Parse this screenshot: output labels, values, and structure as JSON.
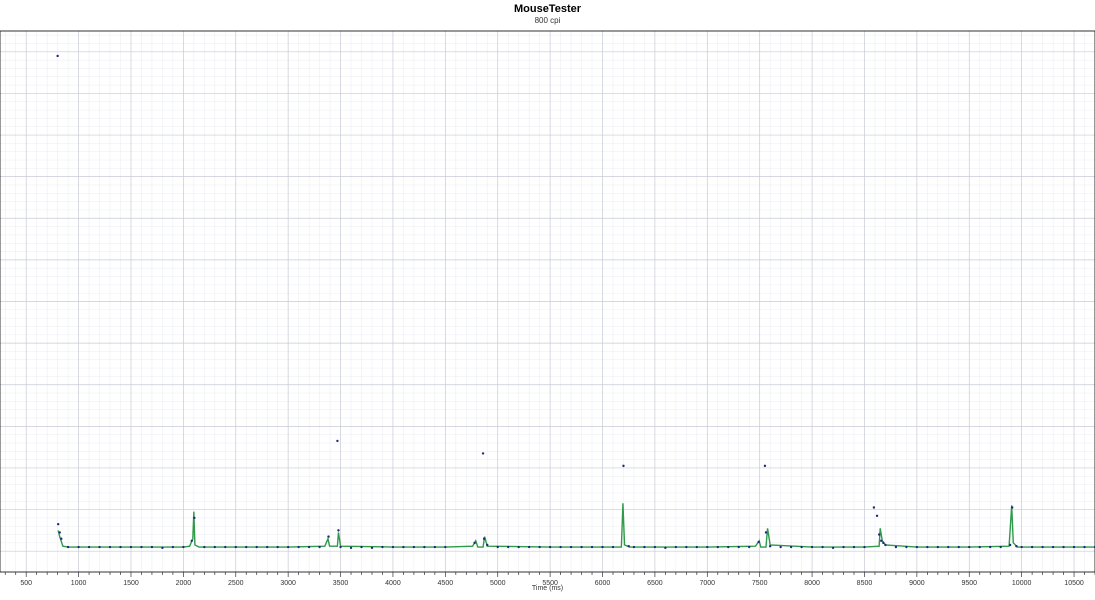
{
  "chart_data": {
    "type": "scatter",
    "title": "MouseTester",
    "subtitle": "800 cpi",
    "xlabel": "Time (ms)",
    "ylabel": "",
    "xlim": [
      250,
      10700
    ],
    "ylim": [
      -0.5,
      12.5
    ],
    "x_major_ticks": [
      500,
      1000,
      1500,
      2000,
      2500,
      3000,
      3500,
      4000,
      4500,
      5000,
      5500,
      6000,
      6500,
      7000,
      7500,
      8000,
      8500,
      9000,
      9500,
      10000,
      10500
    ],
    "x_tick_labels": [
      "500",
      "1000",
      "1500",
      "2000",
      "2500",
      "3000",
      "3500",
      "4000",
      "4500",
      "5000",
      "5500",
      "6000",
      "6500",
      "7000",
      "7500",
      "8000",
      "8500",
      "9000",
      "9500",
      "10000",
      "10500"
    ],
    "grid": true,
    "colors": {
      "points": "#1f2a7a",
      "line": "#2e9a4a",
      "grid_major": "#c8cad6",
      "grid_minor": "#eceef3"
    },
    "series": [
      {
        "kind": "points",
        "points": [
          [
            800,
            11.9
          ],
          [
            805,
            0.65
          ],
          [
            820,
            0.45
          ],
          [
            835,
            0.3
          ],
          [
            900,
            0.1
          ],
          [
            1000,
            0.1
          ],
          [
            1100,
            0.1
          ],
          [
            1200,
            0.1
          ],
          [
            1300,
            0.1
          ],
          [
            1400,
            0.1
          ],
          [
            1500,
            0.1
          ],
          [
            1600,
            0.1
          ],
          [
            1700,
            0.1
          ],
          [
            1800,
            0.08
          ],
          [
            1900,
            0.1
          ],
          [
            2000,
            0.1
          ],
          [
            2080,
            0.25
          ],
          [
            2105,
            0.8
          ],
          [
            2200,
            0.1
          ],
          [
            2300,
            0.1
          ],
          [
            2400,
            0.1
          ],
          [
            2500,
            0.1
          ],
          [
            2600,
            0.1
          ],
          [
            2700,
            0.1
          ],
          [
            2800,
            0.1
          ],
          [
            2900,
            0.1
          ],
          [
            3000,
            0.1
          ],
          [
            3100,
            0.1
          ],
          [
            3200,
            0.1
          ],
          [
            3300,
            0.1
          ],
          [
            3385,
            0.35
          ],
          [
            3470,
            2.65
          ],
          [
            3480,
            0.5
          ],
          [
            3500,
            0.1
          ],
          [
            3600,
            0.08
          ],
          [
            3700,
            0.1
          ],
          [
            3800,
            0.08
          ],
          [
            3900,
            0.1
          ],
          [
            4000,
            0.1
          ],
          [
            4100,
            0.1
          ],
          [
            4200,
            0.1
          ],
          [
            4300,
            0.1
          ],
          [
            4400,
            0.1
          ],
          [
            4500,
            0.1
          ],
          [
            4780,
            0.2
          ],
          [
            4860,
            2.35
          ],
          [
            4870,
            0.3
          ],
          [
            4900,
            0.15
          ],
          [
            5000,
            0.1
          ],
          [
            5100,
            0.1
          ],
          [
            5200,
            0.1
          ],
          [
            5300,
            0.1
          ],
          [
            5400,
            0.1
          ],
          [
            5500,
            0.1
          ],
          [
            5600,
            0.1
          ],
          [
            5700,
            0.1
          ],
          [
            5800,
            0.1
          ],
          [
            5900,
            0.1
          ],
          [
            6000,
            0.1
          ],
          [
            6100,
            0.1
          ],
          [
            6200,
            2.05
          ],
          [
            6250,
            0.12
          ],
          [
            6300,
            0.1
          ],
          [
            6400,
            0.1
          ],
          [
            6500,
            0.1
          ],
          [
            6600,
            0.08
          ],
          [
            6700,
            0.1
          ],
          [
            6800,
            0.1
          ],
          [
            6900,
            0.1
          ],
          [
            7000,
            0.1
          ],
          [
            7100,
            0.1
          ],
          [
            7200,
            0.1
          ],
          [
            7300,
            0.1
          ],
          [
            7400,
            0.1
          ],
          [
            7490,
            0.22
          ],
          [
            7550,
            2.05
          ],
          [
            7560,
            0.45
          ],
          [
            7600,
            0.12
          ],
          [
            7700,
            0.1
          ],
          [
            7800,
            0.1
          ],
          [
            7900,
            0.1
          ],
          [
            8000,
            0.1
          ],
          [
            8100,
            0.1
          ],
          [
            8200,
            0.08
          ],
          [
            8300,
            0.1
          ],
          [
            8400,
            0.1
          ],
          [
            8500,
            0.1
          ],
          [
            8590,
            1.05
          ],
          [
            8620,
            0.85
          ],
          [
            8640,
            0.4
          ],
          [
            8660,
            0.25
          ],
          [
            8680,
            0.2
          ],
          [
            8700,
            0.15
          ],
          [
            8800,
            0.1
          ],
          [
            8900,
            0.1
          ],
          [
            9000,
            0.1
          ],
          [
            9100,
            0.1
          ],
          [
            9200,
            0.1
          ],
          [
            9300,
            0.1
          ],
          [
            9400,
            0.1
          ],
          [
            9500,
            0.1
          ],
          [
            9600,
            0.1
          ],
          [
            9700,
            0.1
          ],
          [
            9800,
            0.1
          ],
          [
            9890,
            0.15
          ],
          [
            9910,
            1.05
          ],
          [
            9950,
            0.12
          ],
          [
            10000,
            0.1
          ],
          [
            10100,
            0.1
          ],
          [
            10200,
            0.1
          ],
          [
            10300,
            0.1
          ],
          [
            10400,
            0.1
          ],
          [
            10500,
            0.1
          ],
          [
            10600,
            0.1
          ],
          [
            10700,
            0.1
          ]
        ]
      },
      {
        "kind": "line",
        "points": [
          [
            805,
            0.5
          ],
          [
            820,
            0.35
          ],
          [
            850,
            0.12
          ],
          [
            900,
            0.1
          ],
          [
            1000,
            0.1
          ],
          [
            1500,
            0.1
          ],
          [
            2000,
            0.1
          ],
          [
            2060,
            0.12
          ],
          [
            2090,
            0.3
          ],
          [
            2100,
            0.95
          ],
          [
            2110,
            0.15
          ],
          [
            2150,
            0.1
          ],
          [
            2500,
            0.1
          ],
          [
            3000,
            0.1
          ],
          [
            3350,
            0.12
          ],
          [
            3380,
            0.3
          ],
          [
            3395,
            0.12
          ],
          [
            3470,
            0.12
          ],
          [
            3480,
            0.45
          ],
          [
            3500,
            0.12
          ],
          [
            4000,
            0.1
          ],
          [
            4500,
            0.1
          ],
          [
            4760,
            0.12
          ],
          [
            4790,
            0.25
          ],
          [
            4810,
            0.1
          ],
          [
            4860,
            0.1
          ],
          [
            4875,
            0.35
          ],
          [
            4900,
            0.12
          ],
          [
            5500,
            0.1
          ],
          [
            6000,
            0.1
          ],
          [
            6180,
            0.1
          ],
          [
            6195,
            1.15
          ],
          [
            6210,
            0.15
          ],
          [
            6260,
            0.1
          ],
          [
            7000,
            0.1
          ],
          [
            7460,
            0.12
          ],
          [
            7495,
            0.25
          ],
          [
            7510,
            0.1
          ],
          [
            7560,
            0.1
          ],
          [
            7575,
            0.55
          ],
          [
            7600,
            0.15
          ],
          [
            8000,
            0.1
          ],
          [
            8500,
            0.1
          ],
          [
            8640,
            0.12
          ],
          [
            8650,
            0.55
          ],
          [
            8670,
            0.25
          ],
          [
            8700,
            0.15
          ],
          [
            9000,
            0.1
          ],
          [
            9500,
            0.1
          ],
          [
            9880,
            0.12
          ],
          [
            9905,
            1.1
          ],
          [
            9920,
            0.2
          ],
          [
            9960,
            0.1
          ],
          [
            10700,
            0.1
          ]
        ]
      }
    ]
  }
}
